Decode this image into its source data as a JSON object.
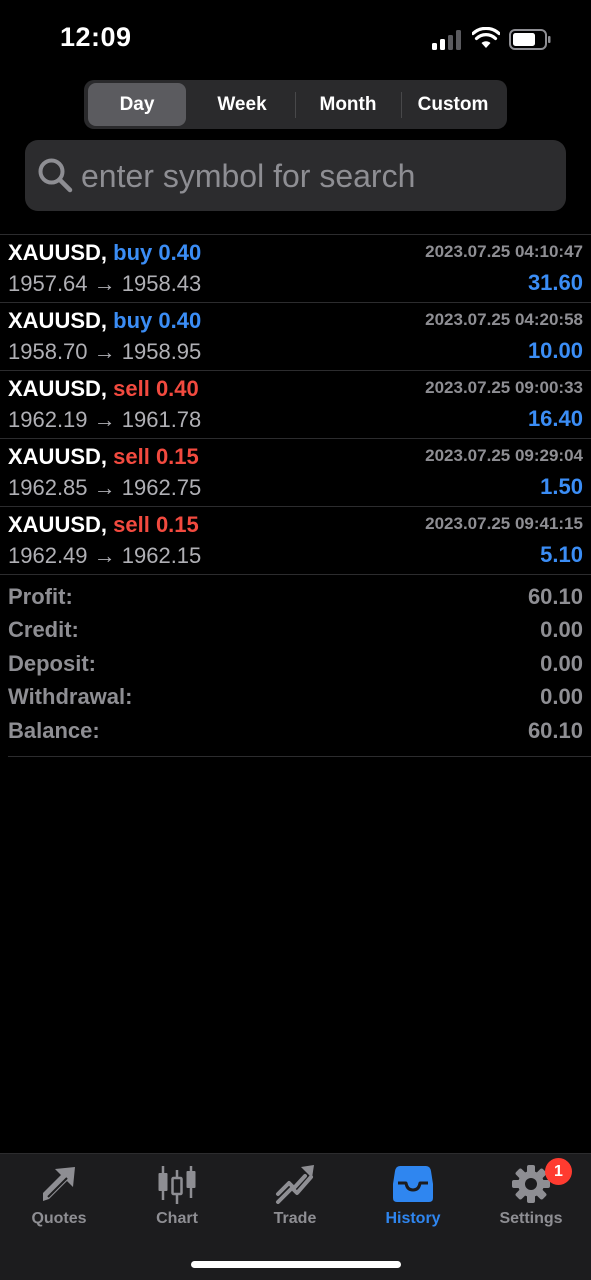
{
  "status_bar": {
    "time": "12:09",
    "battery_level": 0.7,
    "signal_bars": 2
  },
  "period_tabs": [
    {
      "label": "Day",
      "active": true
    },
    {
      "label": "Week",
      "active": false
    },
    {
      "label": "Month",
      "active": false
    },
    {
      "label": "Custom",
      "active": false
    }
  ],
  "search": {
    "placeholder": "enter symbol for search",
    "icon": "search-icon"
  },
  "deals": [
    {
      "symbol": "XAUUSD,",
      "side": "buy 0.40",
      "type": "buy",
      "time": "2023.07.25 04:10:47",
      "prices": "1957.64 → 1958.43",
      "profit": "31.60"
    },
    {
      "symbol": "XAUUSD,",
      "side": "buy 0.40",
      "type": "buy",
      "time": "2023.07.25 04:20:58",
      "prices": "1958.70 → 1958.95",
      "profit": "10.00"
    },
    {
      "symbol": "XAUUSD,",
      "side": "sell 0.40",
      "type": "sell",
      "time": "2023.07.25 09:00:33",
      "prices": "1962.19 → 1961.78",
      "profit": "16.40"
    },
    {
      "symbol": "XAUUSD,",
      "side": "sell 0.15",
      "type": "sell",
      "time": "2023.07.25 09:29:04",
      "prices": "1962.85 → 1962.75",
      "profit": "1.50"
    },
    {
      "symbol": "XAUUSD,",
      "side": "sell 0.15",
      "type": "sell",
      "time": "2023.07.25 09:41:15",
      "prices": "1962.49 → 1962.15",
      "profit": "5.10"
    }
  ],
  "summary": [
    {
      "label": "Profit:",
      "value": "60.10"
    },
    {
      "label": "Credit:",
      "value": "0.00"
    },
    {
      "label": "Deposit:",
      "value": "0.00"
    },
    {
      "label": "Withdrawal:",
      "value": "0.00"
    },
    {
      "label": "Balance:",
      "value": "60.10"
    }
  ],
  "tabbar": [
    {
      "label": "Quotes",
      "icon": "quotes-icon",
      "active": false
    },
    {
      "label": "Chart",
      "icon": "candlestick-icon",
      "active": false
    },
    {
      "label": "Trade",
      "icon": "trade-icon",
      "active": false
    },
    {
      "label": "History",
      "icon": "inbox-icon",
      "active": true
    },
    {
      "label": "Settings",
      "icon": "gear-icon",
      "active": false,
      "badge": "1"
    }
  ],
  "colors": {
    "buy": "#3b8df5",
    "sell": "#f24a3f",
    "active_tab": "#2f86f0",
    "badge": "#ff3b30"
  }
}
